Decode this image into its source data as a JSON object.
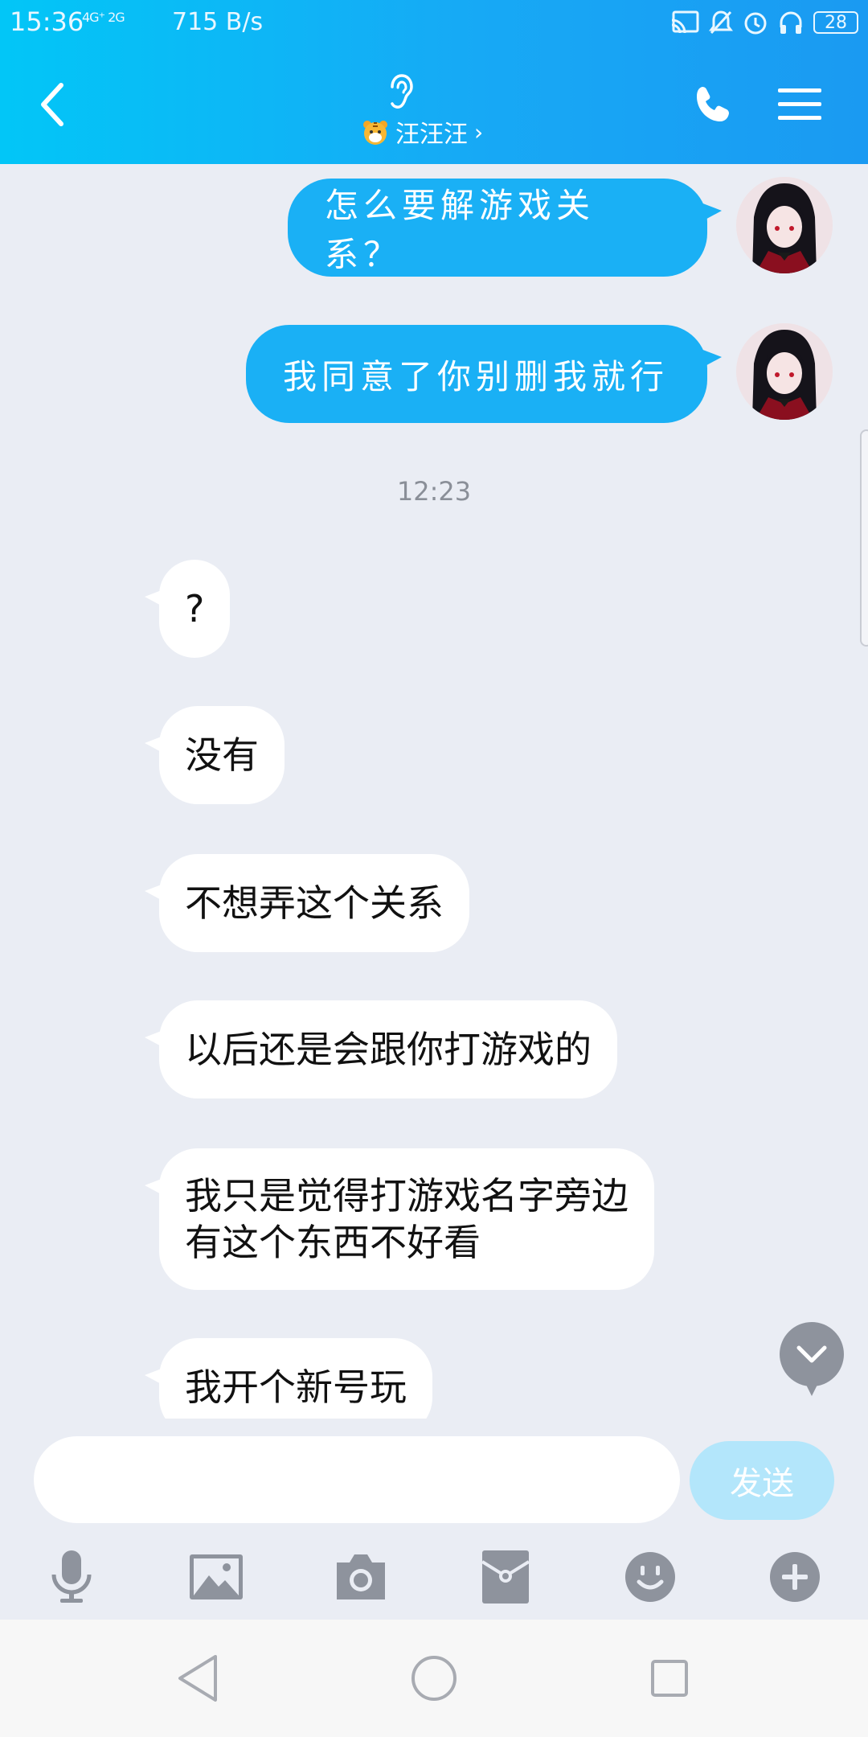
{
  "status_bar": {
    "time": "15:36",
    "signal_text": "4G⁺ 2G",
    "net_speed": "715 B/s",
    "battery": "28"
  },
  "header": {
    "contact_name": "汪汪汪",
    "chevron": "›"
  },
  "messages_out": [
    {
      "text": "怎么要解游戏关系？"
    },
    {
      "text": "我同意了你别删我就行"
    }
  ],
  "timestamp": "12:23",
  "messages_in": [
    {
      "text": "?"
    },
    {
      "text": "没有"
    },
    {
      "text": "不想弄这个关系"
    },
    {
      "text": "以后还是会跟你打游戏的"
    },
    {
      "line1": "我只是觉得打游戏名字旁边",
      "line2": "有这个东西不好看"
    },
    {
      "text": "我开个新号玩"
    }
  ],
  "input": {
    "value": "",
    "send_label": "发送"
  },
  "toolbar_icons": [
    "microphone-icon",
    "image-icon",
    "camera-icon",
    "red-packet-icon",
    "emoji-icon",
    "plus-icon"
  ],
  "colors": {
    "header_start": "#02c6f7",
    "header_end": "#1a9af2",
    "bubble_out": "#1ab0f5",
    "bubble_in": "#ffffff",
    "background": "#eaedf4",
    "send_disabled": "#b3e6fb",
    "toolbar_icon": "#8e939d"
  }
}
